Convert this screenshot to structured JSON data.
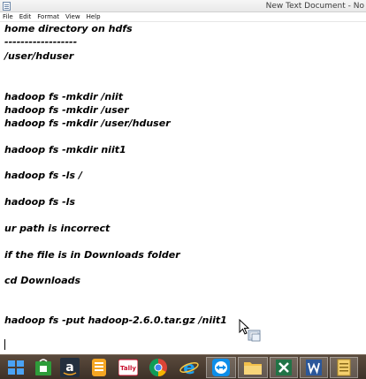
{
  "window": {
    "title": "New Text Document - No",
    "icon": "notepad-icon"
  },
  "menu": {
    "items": [
      "File",
      "Edit",
      "Format",
      "View",
      "Help"
    ]
  },
  "editor": {
    "lines": [
      "home directory on hdfs",
      "------------------",
      "/user/hduser",
      "",
      "",
      "hadoop fs -mkdir /niit",
      "hadoop fs -mkdir /user",
      "hadoop fs -mkdir /user/hduser",
      "",
      "hadoop fs -mkdir niit1",
      "",
      "hadoop fs -ls /",
      "",
      "hadoop fs -ls",
      "",
      "ur path is incorrect",
      "",
      "if the file is in Downloads folder",
      "",
      "cd Downloads",
      "",
      "",
      "hadoop fs -put hadoop-2.6.0.tar.gz /niit1"
    ]
  },
  "taskbar": {
    "items": [
      {
        "icon": "windows-start-icon",
        "label": ""
      },
      {
        "icon": "store-icon",
        "label": ""
      },
      {
        "icon": "amazon-icon",
        "label": "a"
      },
      {
        "icon": "orange-app-icon",
        "label": ""
      },
      {
        "icon": "tally-icon",
        "label": "Tally"
      },
      {
        "icon": "chrome-icon",
        "label": ""
      },
      {
        "icon": "internet-explorer-icon",
        "label": "e"
      },
      {
        "icon": "teamviewer-icon",
        "label": ""
      },
      {
        "icon": "file-explorer-icon",
        "label": ""
      },
      {
        "icon": "excel-icon",
        "label": ""
      },
      {
        "icon": "word-icon",
        "label": ""
      },
      {
        "icon": "notepad-taskbar-icon",
        "label": ""
      }
    ],
    "colors": {
      "background": "#4a3c30",
      "windows": "#4aa3f5",
      "store": "#2e9c3a",
      "amazon": "#232f3e",
      "orange": "#f5a623",
      "tally": "#c8102e",
      "chrome_red": "#db4437",
      "chrome_yellow": "#f4b400",
      "chrome_green": "#0f9d58",
      "chrome_blue": "#4285f4",
      "ie": "#1ea1f1",
      "teamviewer": "#0e8ee9",
      "explorer": "#f3c04b",
      "excel": "#217346",
      "word": "#2b579a"
    }
  }
}
